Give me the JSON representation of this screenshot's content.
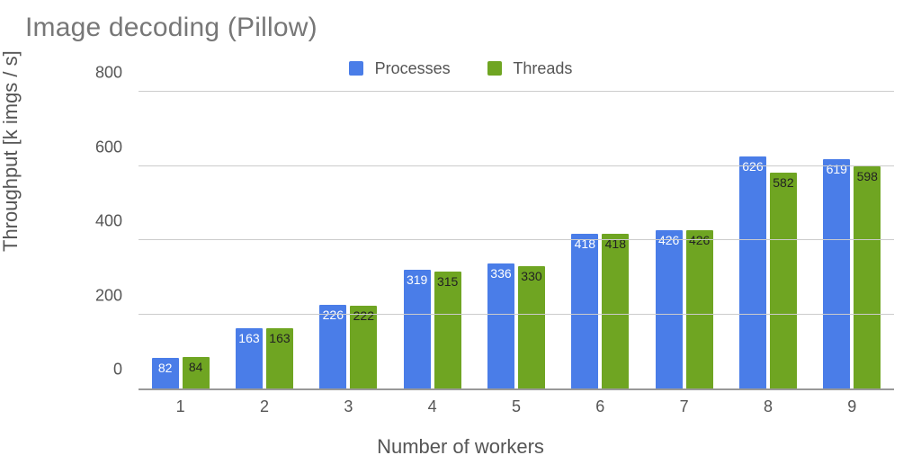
{
  "title": "Image decoding (Pillow)",
  "x_label": "Number of workers",
  "y_label": "Throughput [k imgs / s]",
  "legend": {
    "processes": {
      "label": "Processes",
      "color": "#4a7de8"
    },
    "threads": {
      "label": "Threads",
      "color": "#6fa522"
    }
  },
  "chart_data": {
    "type": "bar",
    "title": "Image decoding (Pillow)",
    "xlabel": "Number of workers",
    "ylabel": "Throughput [k imgs / s]",
    "ylim": [
      0,
      800
    ],
    "yticks": [
      0,
      200,
      400,
      600,
      800
    ],
    "categories": [
      "1",
      "2",
      "3",
      "4",
      "5",
      "6",
      "7",
      "8",
      "9"
    ],
    "series": [
      {
        "name": "Processes",
        "color": "#4a7de8",
        "values": [
          82,
          163,
          226,
          319,
          336,
          418,
          426,
          626,
          619
        ]
      },
      {
        "name": "Threads",
        "color": "#6fa522",
        "values": [
          84,
          163,
          222,
          315,
          330,
          418,
          426,
          582,
          598
        ]
      }
    ],
    "grid": true,
    "legend_position": "top"
  }
}
